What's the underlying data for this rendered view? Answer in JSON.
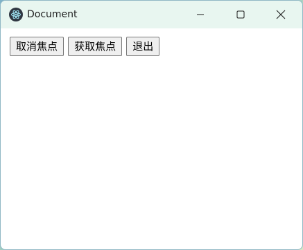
{
  "window": {
    "title": "Document"
  },
  "caption": {
    "icons": [
      "minimize-icon",
      "maximize-icon",
      "close-icon"
    ]
  },
  "buttons": {
    "blur_label": "取消焦点",
    "focus_label": "获取焦点",
    "quit_label": "退出"
  }
}
